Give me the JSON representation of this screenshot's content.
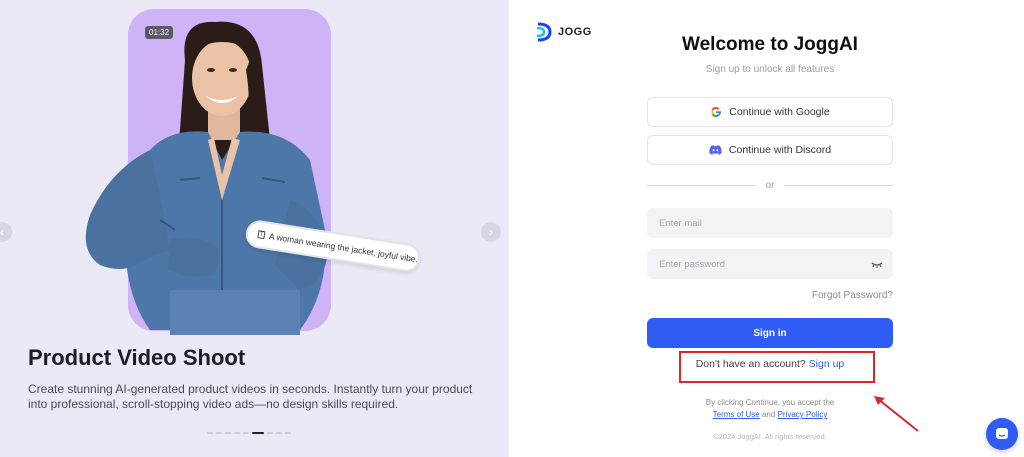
{
  "hero": {
    "timer": "01:32",
    "caption": "A woman wearing the jacket, joyful vibe.",
    "title": "Product Video Shoot",
    "description": "Create stunning AI-generated product videos in seconds. Instantly turn your product into professional, scroll-stopping video ads—no design skills required.",
    "slide_count": 9,
    "active_slide": 5
  },
  "brand": {
    "logo_text": "JOGG"
  },
  "form": {
    "title": "Welcome to JoggAI",
    "subtitle": "Sign up to unlock all features",
    "google_label": "Continue with Google",
    "discord_label": "Continue with Discord",
    "divider_text": "or",
    "mail_placeholder": "Enter mail",
    "password_placeholder": "Enter password",
    "forgot_label": "Forgot Password?",
    "signin_label": "Sign in",
    "no_account_text": "Don't have an account?",
    "signup_label": "Sign up",
    "terms_prefix": "By clicking Continue, you accept the",
    "terms_link": "Terms of Use",
    "terms_and": "and",
    "privacy_link": "Privacy Policy",
    "copyright": "©2024 JoggAI. All rights reserved."
  },
  "colors": {
    "accent": "#2f5cf5",
    "highlight": "#e0262b",
    "card": "#cfb3f7"
  }
}
